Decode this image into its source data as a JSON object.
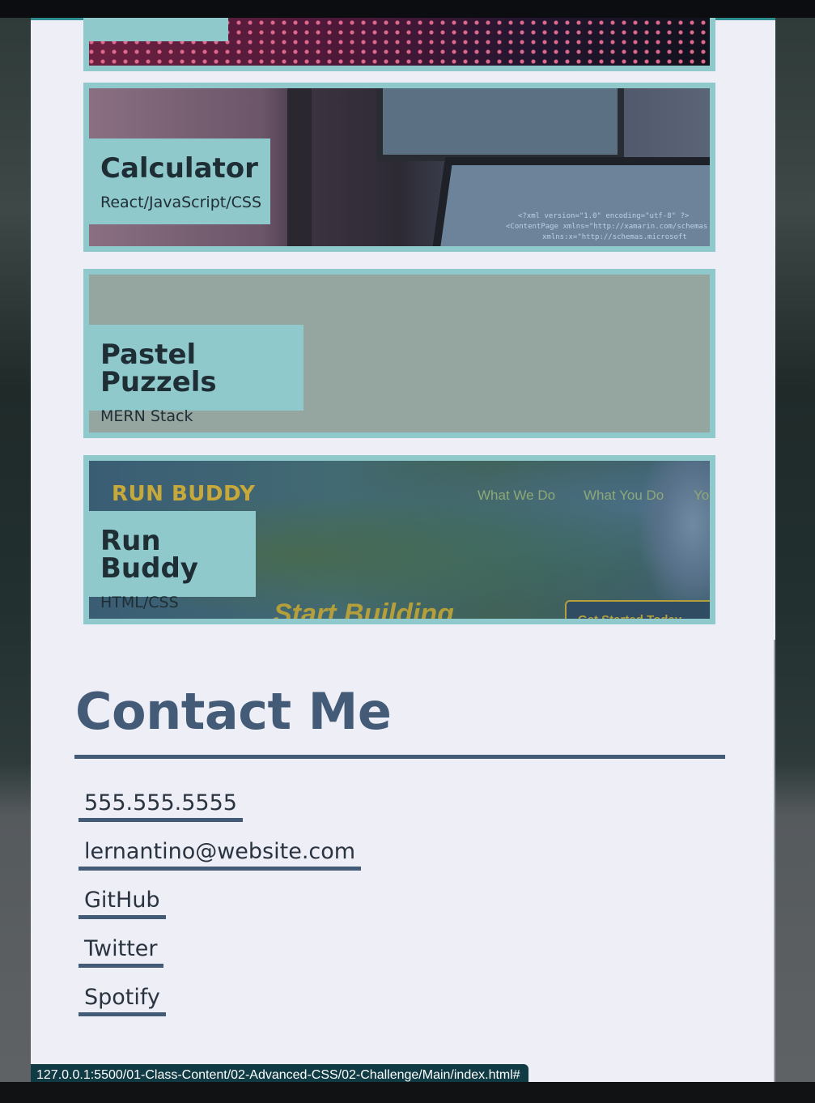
{
  "projects": [
    {
      "title": "",
      "subtitle": ""
    },
    {
      "title": "Calculator",
      "subtitle": "React/JavaScript/CSS",
      "code_lines": [
        "<?xml version=\"1.0\" encoding=\"utf-8\" ?>",
        "<ContentPage xmlns=\"http://xamarin.com/schemas",
        "xmlns:x=\"http://schemas.microsoft"
      ]
    },
    {
      "title": "Pastel Puzzels",
      "subtitle": "MERN Stack"
    },
    {
      "title": "Run Buddy",
      "subtitle": "HTML/CSS",
      "screenshot": {
        "logo": "RUN BUDDY",
        "nav": [
          "What We Do",
          "What You Do",
          "Yo"
        ],
        "hero": "Start Building",
        "cta": "Get Started Today"
      }
    }
  ],
  "contact": {
    "title": "Contact Me",
    "items": [
      "555.555.5555",
      "lernantino@website.com",
      "GitHub",
      "Twitter",
      "Spotify"
    ]
  },
  "status_bar": {
    "url": "127.0.0.1:5500/01-Class-Content/02-Advanced-CSS/02-Challenge/Main/index.html#"
  },
  "colors": {
    "accent": "#8fc9cc",
    "heading": "#445b78",
    "page_bg": "#edeef6",
    "text": "#1f2d35"
  }
}
